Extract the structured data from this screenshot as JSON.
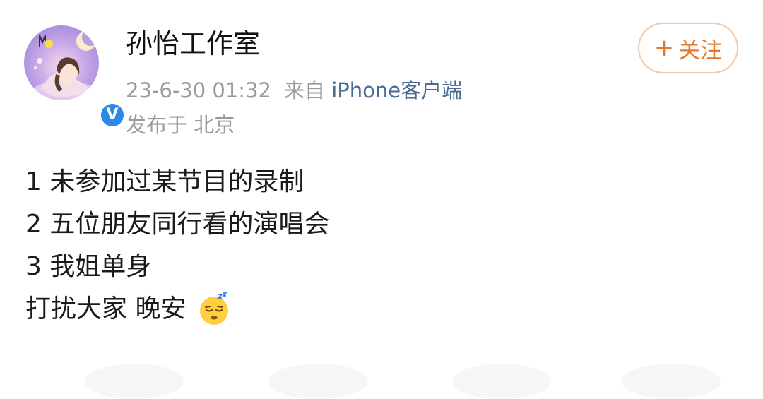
{
  "post": {
    "author": "孙怡工作室",
    "timestamp": "23-6-30 01:32",
    "source_prefix": "来自",
    "source_client": "iPhone客户端",
    "location": "发布于 北京",
    "follow_label": "关注",
    "follow_icon": "+",
    "lines": [
      "1 未参加过某节目的录制",
      "2 五位朋友同行看的演唱会",
      "3 我姐单身",
      "打扰大家 晚安"
    ],
    "emoji": "sleeping-face-icon"
  },
  "colors": {
    "accent": "#e8792c",
    "follow_border": "#f0c9a3",
    "verified": "#2a88e8",
    "meta_text": "#9a9a9a",
    "client_link": "#4a6a96"
  }
}
